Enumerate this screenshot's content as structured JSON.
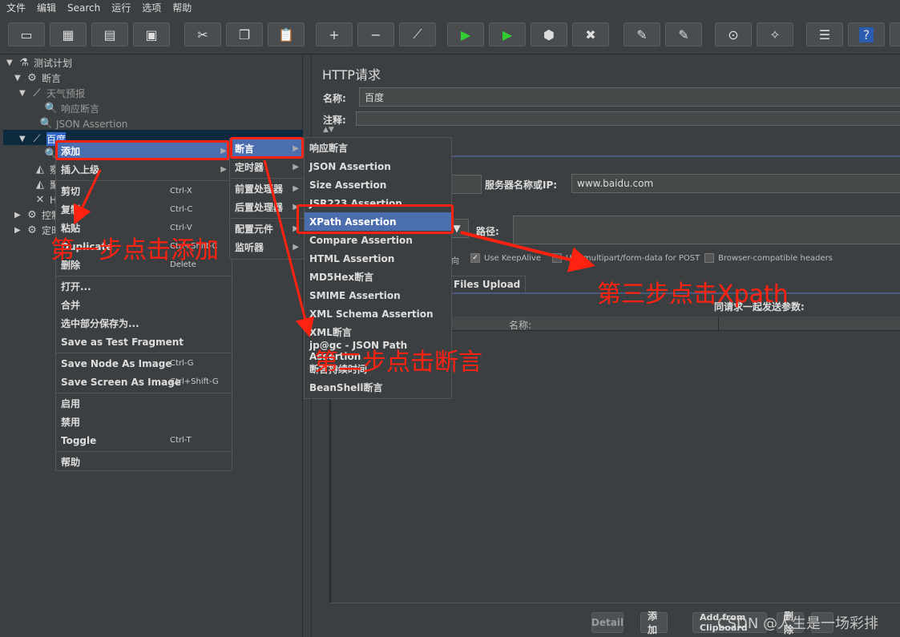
{
  "menubar": [
    "文件",
    "编辑",
    "Search",
    "运行",
    "选项",
    "帮助"
  ],
  "toolbar": [
    {
      "icon": "new-icon",
      "g": "▭"
    },
    {
      "icon": "templates-icon",
      "g": "▦"
    },
    {
      "icon": "open-icon",
      "g": "▤"
    },
    {
      "icon": "save-icon",
      "g": "▣"
    },
    {
      "icon": "cut-icon",
      "g": "✂"
    },
    {
      "icon": "copy-icon",
      "g": "❐"
    },
    {
      "icon": "paste-icon",
      "g": "📋"
    },
    {
      "icon": "expand-icon",
      "g": "+"
    },
    {
      "icon": "collapse-icon",
      "g": "−"
    },
    {
      "icon": "toggle-icon",
      "g": "⟋"
    },
    {
      "icon": "start-icon",
      "g": "▶"
    },
    {
      "icon": "start-no-pause-icon",
      "g": "▶"
    },
    {
      "icon": "stop-icon",
      "g": "⬢"
    },
    {
      "icon": "shutdown-icon",
      "g": "✖"
    },
    {
      "icon": "clear-icon",
      "g": "✎"
    },
    {
      "icon": "clear-all-icon",
      "g": "✎"
    },
    {
      "icon": "search-icon",
      "g": "⊙"
    },
    {
      "icon": "reset-search-icon",
      "g": "✧"
    },
    {
      "icon": "function-helper-icon",
      "g": "☰"
    },
    {
      "icon": "help-icon",
      "g": "?"
    },
    {
      "icon": "more-icon",
      "g": "▪"
    }
  ],
  "tree": [
    {
      "label": "测试计划",
      "icon": "test-plan-icon",
      "g": "⚗",
      "exp": "▼"
    },
    {
      "label": "断言",
      "icon": "thread-group-icon",
      "g": "⚙",
      "exp": "▼"
    },
    {
      "label": "天气预报",
      "icon": "sampler-icon",
      "g": "⟋",
      "exp": "▼"
    },
    {
      "label": "响应断言",
      "icon": "assertion-icon",
      "g": "🔍",
      "exp": ""
    },
    {
      "label": "JSON Assertion",
      "icon": "assertion-icon",
      "g": "🔍",
      "exp": ""
    },
    {
      "label": "百度",
      "icon": "sampler-icon",
      "g": "⟋",
      "exp": "▼"
    },
    {
      "label": "",
      "icon": "assertion-icon",
      "g": "🔍",
      "exp": ""
    },
    {
      "label": "察看",
      "icon": "listener-icon",
      "g": "◭",
      "exp": ""
    },
    {
      "label": "聚合",
      "icon": "listener-icon",
      "g": "◭",
      "exp": ""
    },
    {
      "label": "HT",
      "icon": "config-icon",
      "g": "✕",
      "exp": ""
    },
    {
      "label": "控制",
      "icon": "controller-icon",
      "g": "⚙",
      "exp": "▶"
    },
    {
      "label": "定时",
      "icon": "controller-icon",
      "g": "⚙",
      "exp": "▶"
    }
  ],
  "context_menu": [
    {
      "label": "添加",
      "arrow": true,
      "sel": true
    },
    {
      "label": "插入上级",
      "arrow": true
    },
    {
      "sep": true
    },
    {
      "label": "剪切",
      "sc": "Ctrl-X"
    },
    {
      "label": "复制",
      "sc": "Ctrl-C"
    },
    {
      "label": "粘贴",
      "sc": "Ctrl-V"
    },
    {
      "label": "Duplicate",
      "sc": "Ctrl+Shift-C"
    },
    {
      "label": "删除",
      "sc": "Delete"
    },
    {
      "sep": true
    },
    {
      "label": "打开..."
    },
    {
      "label": "合并"
    },
    {
      "label": "选中部分保存为..."
    },
    {
      "label": "Save as Test Fragment"
    },
    {
      "sep": true
    },
    {
      "label": "Save Node As Image",
      "sc": "Ctrl-G"
    },
    {
      "label": "Save Screen As Image",
      "sc": "Ctrl+Shift-G"
    },
    {
      "sep": true
    },
    {
      "label": "启用"
    },
    {
      "label": "禁用"
    },
    {
      "label": "Toggle",
      "sc": "Ctrl-T"
    },
    {
      "sep": true
    },
    {
      "label": "帮助"
    }
  ],
  "add_submenu": [
    {
      "label": "断言",
      "arrow": true,
      "sel": true
    },
    {
      "label": "定时器",
      "arrow": true
    },
    {
      "sep": true
    },
    {
      "label": "前置处理器",
      "arrow": true
    },
    {
      "label": "后置处理器",
      "arrow": true
    },
    {
      "sep": true
    },
    {
      "label": "配置元件",
      "arrow": true
    },
    {
      "label": "监听器",
      "arrow": true
    }
  ],
  "assertion_submenu": [
    {
      "label": "响应断言"
    },
    {
      "label": "JSON Assertion"
    },
    {
      "label": "Size Assertion"
    },
    {
      "label": "JSR223 Assertion"
    },
    {
      "label": "XPath Assertion",
      "sel": true
    },
    {
      "label": "Compare Assertion"
    },
    {
      "label": "HTML Assertion"
    },
    {
      "label": "MD5Hex断言"
    },
    {
      "label": "SMIME Assertion"
    },
    {
      "label": "XML Schema Assertion"
    },
    {
      "label": "XML断言"
    },
    {
      "label": "jp@gc - JSON Path Assertion"
    },
    {
      "label": "断言持续时间"
    },
    {
      "label": "BeanShell断言"
    }
  ],
  "panel": {
    "title": "HTTP请求",
    "name_label": "名称:",
    "name_value": "百度",
    "comment_label": "注释:",
    "server_label": "服务器名称或IP:",
    "server_value": "www.baidu.com",
    "path_label": "路径:",
    "redirect_tail": "向",
    "keepalive": "Use KeepAlive",
    "multipart": "Use multipart/form-data for POST",
    "browser_headers": "Browser-compatible headers",
    "tab_files": "Files Upload",
    "params_caption": "同请求一起发送参数:",
    "col_name": "名称:",
    "buttons": [
      "Detail",
      "添加",
      "Add from Clipboard",
      "删除",
      ""
    ]
  },
  "annotations": {
    "step1": "第一步点击添加",
    "step2": "第二步点击断言",
    "step3": "第三步点击Xpath",
    "color": "#ff2211"
  },
  "watermark": "CSDN @人生是一场彩排",
  "colors": {
    "bg": "#3c3f41",
    "selection": "#4b6eaf"
  }
}
